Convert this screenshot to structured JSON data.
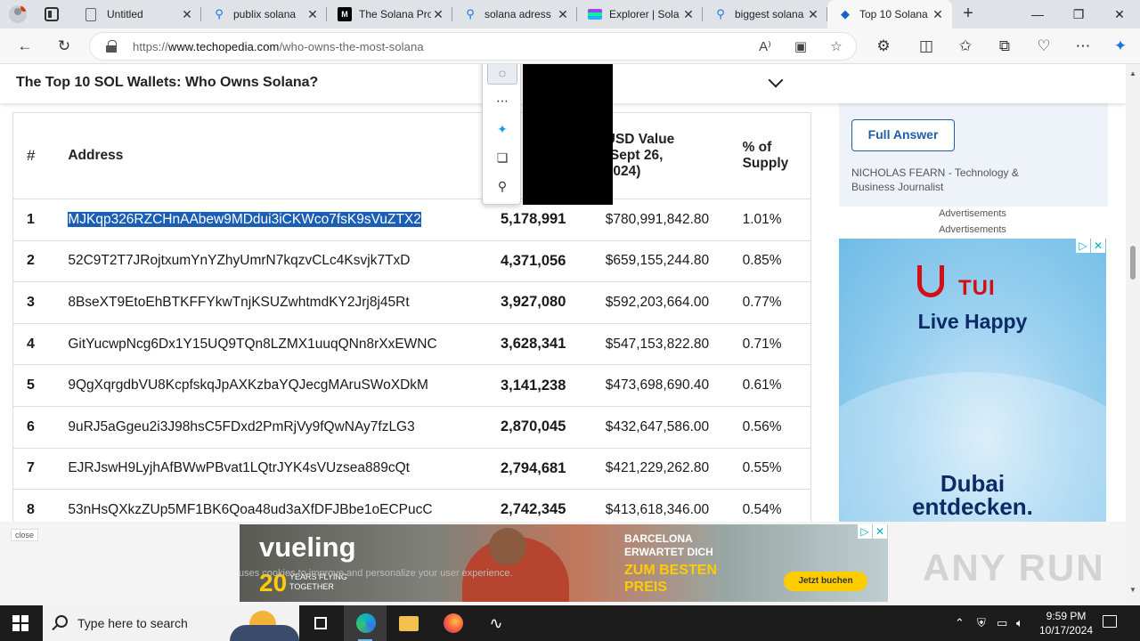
{
  "tabs": [
    {
      "label": "Untitled",
      "icon": "document-icon"
    },
    {
      "label": "publix solana",
      "icon": "search-icon"
    },
    {
      "label": "The Solana Pro",
      "icon": "medium-icon"
    },
    {
      "label": "solana adress",
      "icon": "search-icon"
    },
    {
      "label": "Explorer | Sola",
      "icon": "solana-explorer-icon"
    },
    {
      "label": "biggest solana",
      "icon": "search-icon"
    },
    {
      "label": "Top 10 Solana",
      "icon": "techopedia-icon"
    }
  ],
  "address_bar": {
    "url_prefix": "https://",
    "url_domain": "www.techopedia.com",
    "url_path": "/who-owns-the-most-solana"
  },
  "sticky_header": {
    "title": "The Top 10 SOL Wallets: Who Owns Solana?"
  },
  "table": {
    "headers": [
      "#",
      "Address",
      "USD Value (Sept 26, 2024)",
      "% of Supply"
    ],
    "header_usd_lines": [
      "USD Value",
      "(Sept 26,",
      "2024)"
    ],
    "header_pct_lines": [
      "% of",
      "Supply"
    ],
    "rows": [
      {
        "rank": "1",
        "address": "MJKqp326RZCHnAAbew9MDdui3iCKWco7fsK9sVuZTX2",
        "amount": "5,178,991",
        "usd": "$780,991,842.80",
        "pct": "1.01%"
      },
      {
        "rank": "2",
        "address": "52C9T2T7JRojtxumYnYZhyUmrN7kqzvCLc4Ksvjk7TxD",
        "amount": "4,371,056",
        "usd": "$659,155,244.80",
        "pct": "0.85%"
      },
      {
        "rank": "3",
        "address": "8BseXT9EtoEhBTKFFYkwTnjKSUZwhtmdKY2Jrj8j45Rt",
        "amount": "3,927,080",
        "usd": "$592,203,664.00",
        "pct": "0.77%"
      },
      {
        "rank": "4",
        "address": "GitYucwpNcg6Dx1Y15UQ9TQn8LZMX1uuqQNn8rXxEWNC",
        "amount": "3,628,341",
        "usd": "$547,153,822.80",
        "pct": "0.71%"
      },
      {
        "rank": "5",
        "address": "9QgXqrgdbVU8KcpfskqJpAXKzbaYQJecgMAruSWoXDkM",
        "amount": "3,141,238",
        "usd": "$473,698,690.40",
        "pct": "0.61%"
      },
      {
        "rank": "6",
        "address": "9uRJ5aGgeu2i3J98hsC5FDxd2PmRjVy9fQwNAy7fzLG3",
        "amount": "2,870,045",
        "usd": "$432,647,586.00",
        "pct": "0.56%"
      },
      {
        "rank": "7",
        "address": "EJRJswH9LyjhAfBWwPBvat1LQtrJYK4sVUzsea889cQt",
        "amount": "2,794,681",
        "usd": "$421,229,262.80",
        "pct": "0.55%"
      },
      {
        "rank": "8",
        "address": "53nHsQXkzZUp5MF1BK6Qoa48ud3aXfDFJBbe1oECPucC",
        "amount": "2,742,345",
        "usd": "$413,618,346.00",
        "pct": "0.54%"
      }
    ]
  },
  "sidebar": {
    "button_label": "Full Answer",
    "author_name": "NICHOLAS FEARN",
    "author_role": "- Technology & Business Journalist",
    "ad_label_1": "Advertisements",
    "ad_label_2": "Advertisements"
  },
  "tui_ad": {
    "brand": "TUI",
    "slogan": "Live Happy",
    "headline_1": "Dubai",
    "headline_2": "entdecken."
  },
  "bottom_overlay": {
    "close_label": "close",
    "cookie_text": "uses cookies to improve and personalize your user experience.",
    "vueling": {
      "logo": "vueling",
      "years_num": "20",
      "years_text_1": "YEARS FLYING",
      "years_text_2": "TOGETHER",
      "headline_1": "BARCELONA",
      "headline_2": "ERWARTET DICH",
      "highlight_1": "ZUM BESTEN",
      "highlight_2": "PREIS",
      "cta": "Jetzt buchen"
    },
    "watermark": "ANY RUN"
  },
  "taskbar": {
    "search_placeholder": "Type here to search",
    "time": "9:59 PM",
    "date": "10/17/2024"
  },
  "colors": {
    "selection": "#1a5fb4",
    "link_blue": "#1e5fa8",
    "tui_red": "#d40e14",
    "vueling_yellow": "#ffcc00"
  }
}
